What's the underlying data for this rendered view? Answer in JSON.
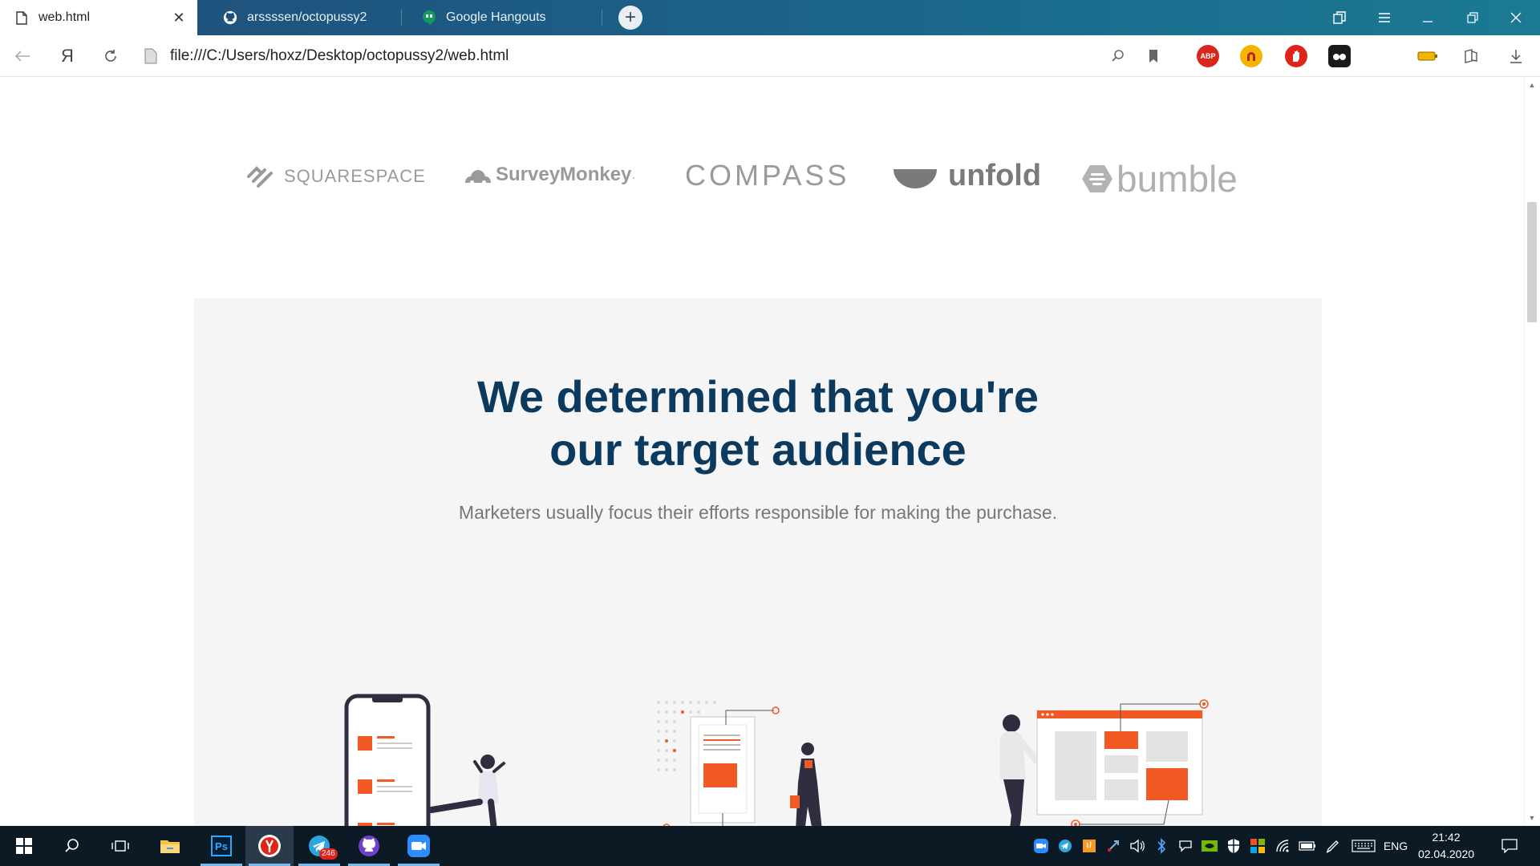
{
  "tabs": [
    {
      "title": "web.html",
      "active": true
    },
    {
      "title": "arssssen/octopussy2",
      "active": false
    },
    {
      "title": "Google Hangouts",
      "active": false
    }
  ],
  "address_bar": {
    "url": "file:///C:/Users/hoxz/Desktop/octopussy2/web.html"
  },
  "extensions": {
    "abp_label": "ABP"
  },
  "page": {
    "logos": {
      "squarespace": "SQUARESPACE",
      "surveymonkey": "SurveyMonkey",
      "surveymonkey_mark": "·",
      "compass": "COMPASS",
      "unfold": "unfold",
      "bumble": "bumble"
    },
    "headline_line1": "We determined that you're",
    "headline_line2": "our target audience",
    "subtext": "Marketers usually focus their efforts responsible for making the purchase.",
    "colors": {
      "headline": "#0b3a5e",
      "accent": "#f15a24",
      "section_bg": "#f5f5f5",
      "logo_gray": "#9a9a9a"
    }
  },
  "taskbar": {
    "telegram_badge": "246",
    "language": "ENG",
    "time": "21:42",
    "date": "02.04.2020"
  }
}
